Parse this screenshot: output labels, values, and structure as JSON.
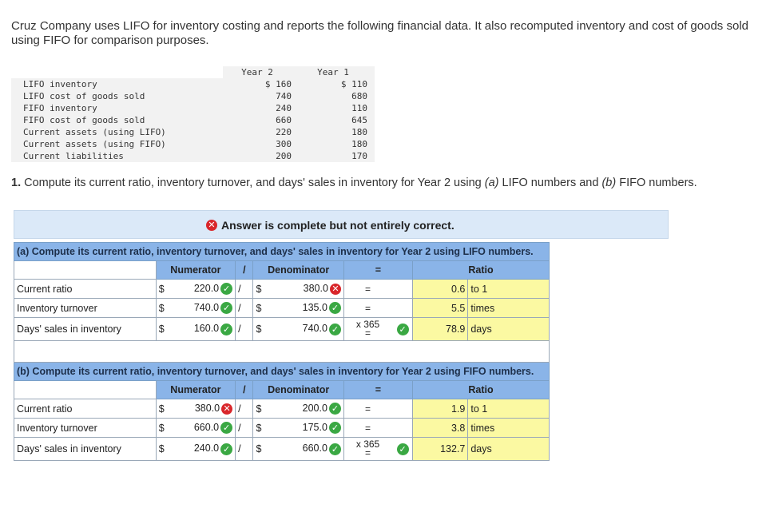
{
  "intro": "Cruz Company uses LIFO for inventory costing and reports the following financial data. It also recomputed inventory and cost of goods sold using FIFO for comparison purposes.",
  "data_table": {
    "year2_label": "Year 2",
    "year1_label": "Year 1",
    "rows": [
      {
        "label": "LIFO inventory",
        "y2": "$ 160",
        "y1": "$ 110"
      },
      {
        "label": "LIFO cost of goods sold",
        "y2": "740",
        "y1": "680"
      },
      {
        "label": "FIFO inventory",
        "y2": "240",
        "y1": "110"
      },
      {
        "label": "FIFO cost of goods sold",
        "y2": "660",
        "y1": "645"
      },
      {
        "label": "Current assets (using LIFO)",
        "y2": "220",
        "y1": "180"
      },
      {
        "label": "Current assets (using FIFO)",
        "y2": "300",
        "y1": "180"
      },
      {
        "label": "Current liabilities",
        "y2": "200",
        "y1": "170"
      }
    ]
  },
  "question": {
    "number": "1.",
    "text_a": " Compute its current ratio, inventory turnover, and days' sales in inventory for Year 2 using ",
    "a": "(a)",
    "text_b": " LIFO numbers and ",
    "b": "(b)",
    "text_c": " FIFO numbers."
  },
  "banner": "Answer is complete but not entirely correct.",
  "headers": {
    "numerator": "Numerator",
    "slash": "/",
    "denominator": "Denominator",
    "equals": "=",
    "ratio": "Ratio"
  },
  "section_a": {
    "title": "(a) Compute its current ratio, inventory turnover, and days' sales in inventory for Year 2 using LIFO numbers.",
    "rows": [
      {
        "label": "Current ratio",
        "num": "220.0",
        "num_ok": true,
        "den": "380.0",
        "den_ok": false,
        "op": "=",
        "result": "0.6",
        "unit": "to 1"
      },
      {
        "label": "Inventory turnover",
        "num": "740.0",
        "num_ok": true,
        "den": "135.0",
        "den_ok": true,
        "op": "=",
        "result": "5.5",
        "unit": "times"
      },
      {
        "label": "Days' sales in inventory",
        "num": "160.0",
        "num_ok": true,
        "den": "740.0",
        "den_ok": true,
        "op": "x 365 =",
        "result": "78.9",
        "unit": "days"
      }
    ]
  },
  "section_b": {
    "title": "(b) Compute its current ratio, inventory turnover, and days' sales in inventory for Year 2 using FIFO numbers.",
    "rows": [
      {
        "label": "Current ratio",
        "num": "380.0",
        "num_ok": false,
        "den": "200.0",
        "den_ok": true,
        "op": "=",
        "result": "1.9",
        "unit": "to 1"
      },
      {
        "label": "Inventory turnover",
        "num": "660.0",
        "num_ok": true,
        "den": "175.0",
        "den_ok": true,
        "op": "=",
        "result": "3.8",
        "unit": "times"
      },
      {
        "label": "Days' sales in inventory",
        "num": "240.0",
        "num_ok": true,
        "den": "660.0",
        "den_ok": true,
        "op": "x 365 =",
        "result": "132.7",
        "unit": "days"
      }
    ]
  },
  "currency": "$",
  "colors": {
    "correct": "#3aa843",
    "incorrect": "#d9262b",
    "header": "#8ab4e8",
    "answer_cell": "#fbf9a2",
    "banner": "#dbe9f8"
  }
}
